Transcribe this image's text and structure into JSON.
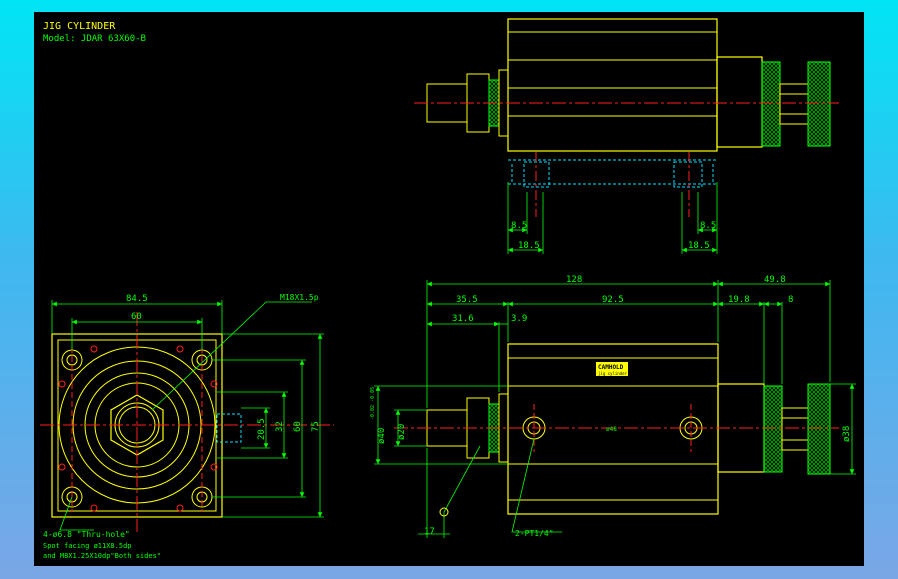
{
  "title": "JIG CYLINDER",
  "model": "Model: JDAR 63X60-B",
  "colors": {
    "background": "#000000",
    "outline": "#ffff00",
    "dimension": "#00ff00",
    "centerline": "#ff2020",
    "hidden": "#00e0ff",
    "frame_gradient_top": "#00e5f5",
    "frame_gradient_bottom": "#7aa6e6"
  },
  "front_view": {
    "dim_width_outer": "84.5",
    "dim_width_inner": "60",
    "dim_height_outer": "75",
    "dim_height_mid": "60",
    "dim_height_inner": "32",
    "dim_port": "20.5",
    "thread_label": "M18X1.5p",
    "hole_note_1": "4-ø6.8  \"Thru-hole\"",
    "hole_note_2": "Spot facing  ø11X8.5dp",
    "hole_note_3": "and M8X1.25X10dp\"Both sides\""
  },
  "top_view": {
    "dim_left_small": "8.5",
    "dim_right_small": "8.5",
    "dim_left_large": "18.5",
    "dim_right_large": "18.5"
  },
  "side_view": {
    "dim_total": "128",
    "dim_extension": "49.8",
    "dim_rod_length": "35.5",
    "dim_body": "92.5",
    "dim_knob": "19.8",
    "dim_knob_thin": "8",
    "dim_rod_inner": "31.6",
    "dim_nut": "3.9",
    "dim_bore": "ø40",
    "dim_bore_tol": "-0.02 -0.05",
    "dim_rod_dia": "ø20",
    "dim_knob_dia": "ø38",
    "dim_bottom": "17",
    "port_label": "2-PT1/4\"",
    "body_mark": "ø48",
    "logo_text": "CAMHOLD",
    "logo_sub": "jig cylinder"
  }
}
